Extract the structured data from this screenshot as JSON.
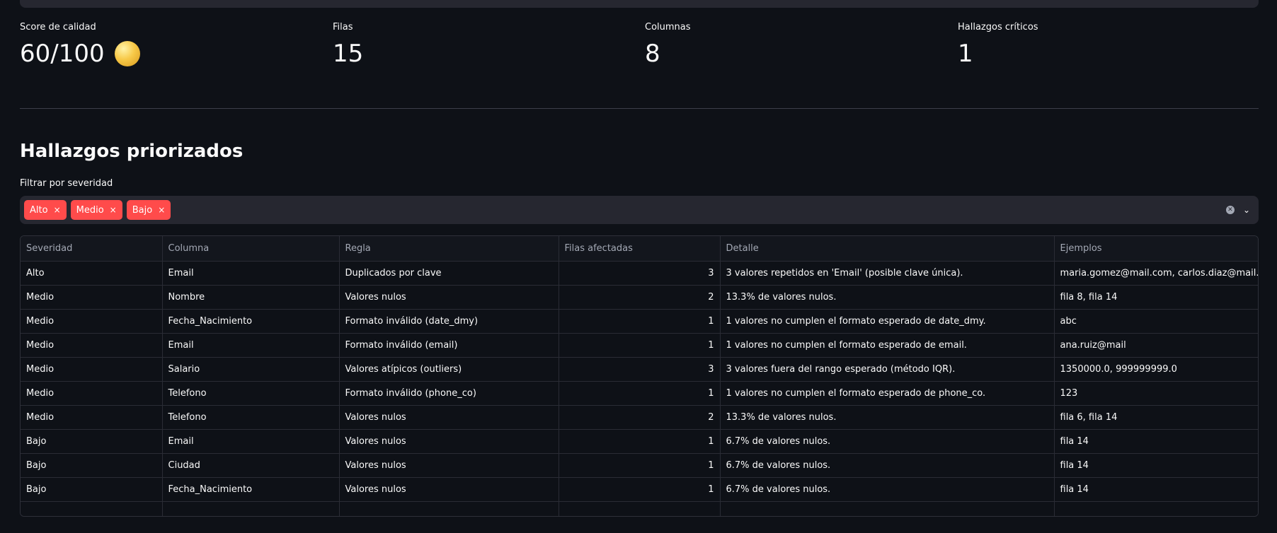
{
  "metrics": [
    {
      "label": "Score de calidad",
      "value": "60/100",
      "icon": "yellow-circle"
    },
    {
      "label": "Filas",
      "value": "15"
    },
    {
      "label": "Columnas",
      "value": "8"
    },
    {
      "label": "Hallazgos críticos",
      "value": "1"
    }
  ],
  "section_title": "Hallazgos priorizados",
  "filter": {
    "label": "Filtrar por severidad",
    "chips": [
      "Alto",
      "Medio",
      "Bajo"
    ],
    "chip_remove": "×",
    "clear_icon": "✕",
    "chevron_icon": "⌄"
  },
  "colors": {
    "background": "#0e1117",
    "chip": "#ff4b4b",
    "panel": "#262730"
  },
  "table": {
    "headers": [
      "Severidad",
      "Columna",
      "Regla",
      "Filas afectadas",
      "Detalle",
      "Ejemplos"
    ],
    "rows": [
      [
        "Alto",
        "Email",
        "Duplicados por clave",
        "3",
        "3 valores repetidos en 'Email' (posible clave única).",
        "maria.gomez@mail.com, carlos.diaz@mail.com"
      ],
      [
        "Medio",
        "Nombre",
        "Valores nulos",
        "2",
        "13.3% de valores nulos.",
        "fila 8, fila 14"
      ],
      [
        "Medio",
        "Fecha_Nacimiento",
        "Formato inválido (date_dmy)",
        "1",
        "1 valores no cumplen el formato esperado de date_dmy.",
        "abc"
      ],
      [
        "Medio",
        "Email",
        "Formato inválido (email)",
        "1",
        "1 valores no cumplen el formato esperado de email.",
        "ana.ruiz@mail"
      ],
      [
        "Medio",
        "Salario",
        "Valores atípicos (outliers)",
        "3",
        "3 valores fuera del rango esperado (método IQR).",
        "1350000.0, 999999999.0"
      ],
      [
        "Medio",
        "Telefono",
        "Formato inválido (phone_co)",
        "1",
        "1 valores no cumplen el formato esperado de phone_co.",
        "123"
      ],
      [
        "Medio",
        "Telefono",
        "Valores nulos",
        "2",
        "13.3% de valores nulos.",
        "fila 6, fila 14"
      ],
      [
        "Bajo",
        "Email",
        "Valores nulos",
        "1",
        "6.7% de valores nulos.",
        "fila 14"
      ],
      [
        "Bajo",
        "Ciudad",
        "Valores nulos",
        "1",
        "6.7% de valores nulos.",
        "fila 14"
      ],
      [
        "Bajo",
        "Fecha_Nacimiento",
        "Valores nulos",
        "1",
        "6.7% de valores nulos.",
        "fila 14"
      ]
    ]
  }
}
